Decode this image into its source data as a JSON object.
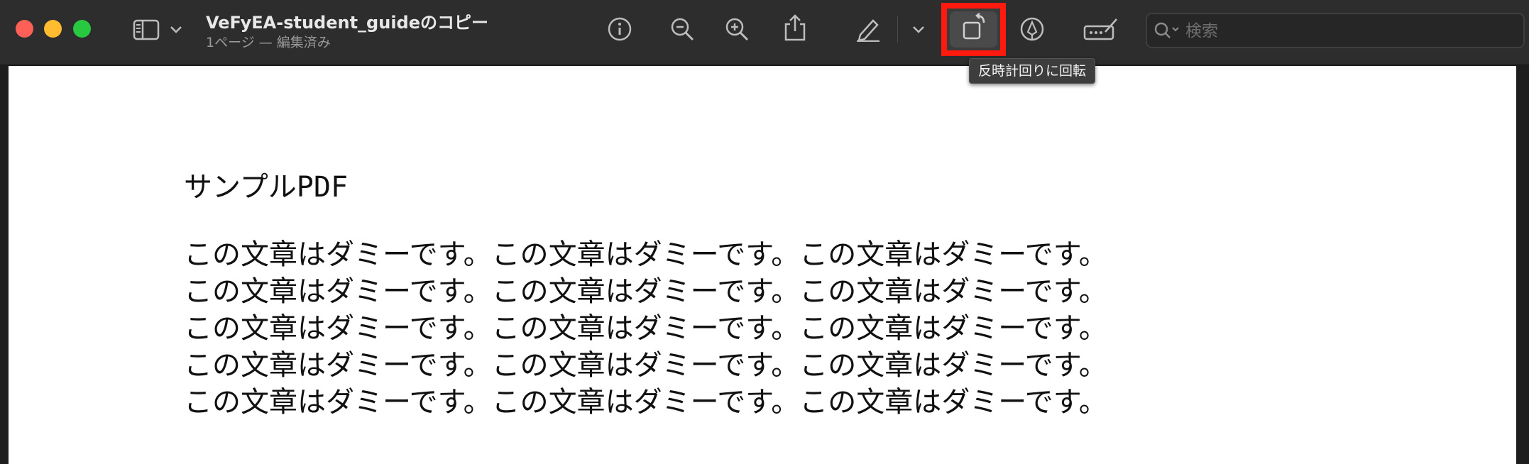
{
  "window": {
    "title": "VeFyEA-student_guideのコピー",
    "subtitle": "1ページ — 編集済み"
  },
  "toolbar": {
    "buttons": [
      {
        "name": "sidebar-toggle",
        "icon": "sidebar-icon"
      },
      {
        "name": "sidebar-menu",
        "icon": "chevron-down-icon"
      },
      {
        "name": "info",
        "icon": "info-icon"
      },
      {
        "name": "zoom-out",
        "icon": "zoom-out-icon"
      },
      {
        "name": "zoom-in",
        "icon": "zoom-in-icon"
      },
      {
        "name": "share",
        "icon": "share-icon"
      },
      {
        "name": "markup",
        "icon": "pencil-icon"
      },
      {
        "name": "markup-menu",
        "icon": "chevron-down-icon"
      },
      {
        "name": "rotate-left",
        "icon": "rotate-left-icon"
      },
      {
        "name": "annotate",
        "icon": "pen-circle-icon"
      },
      {
        "name": "form-fill",
        "icon": "form-fill-icon"
      }
    ],
    "highlight_color": "#ff1a0f"
  },
  "search": {
    "placeholder": "検索",
    "value": ""
  },
  "tooltip": {
    "text": "反時計回りに回転"
  },
  "document": {
    "title": "サンプルPDF",
    "lines": [
      "この文章はダミーです。この文章はダミーです。この文章はダミーです。",
      "この文章はダミーです。この文章はダミーです。この文章はダミーです。",
      "この文章はダミーです。この文章はダミーです。この文章はダミーです。",
      "この文章はダミーです。この文章はダミーです。この文章はダミーです。",
      "この文章はダミーです。この文章はダミーです。この文章はダミーです。"
    ]
  }
}
